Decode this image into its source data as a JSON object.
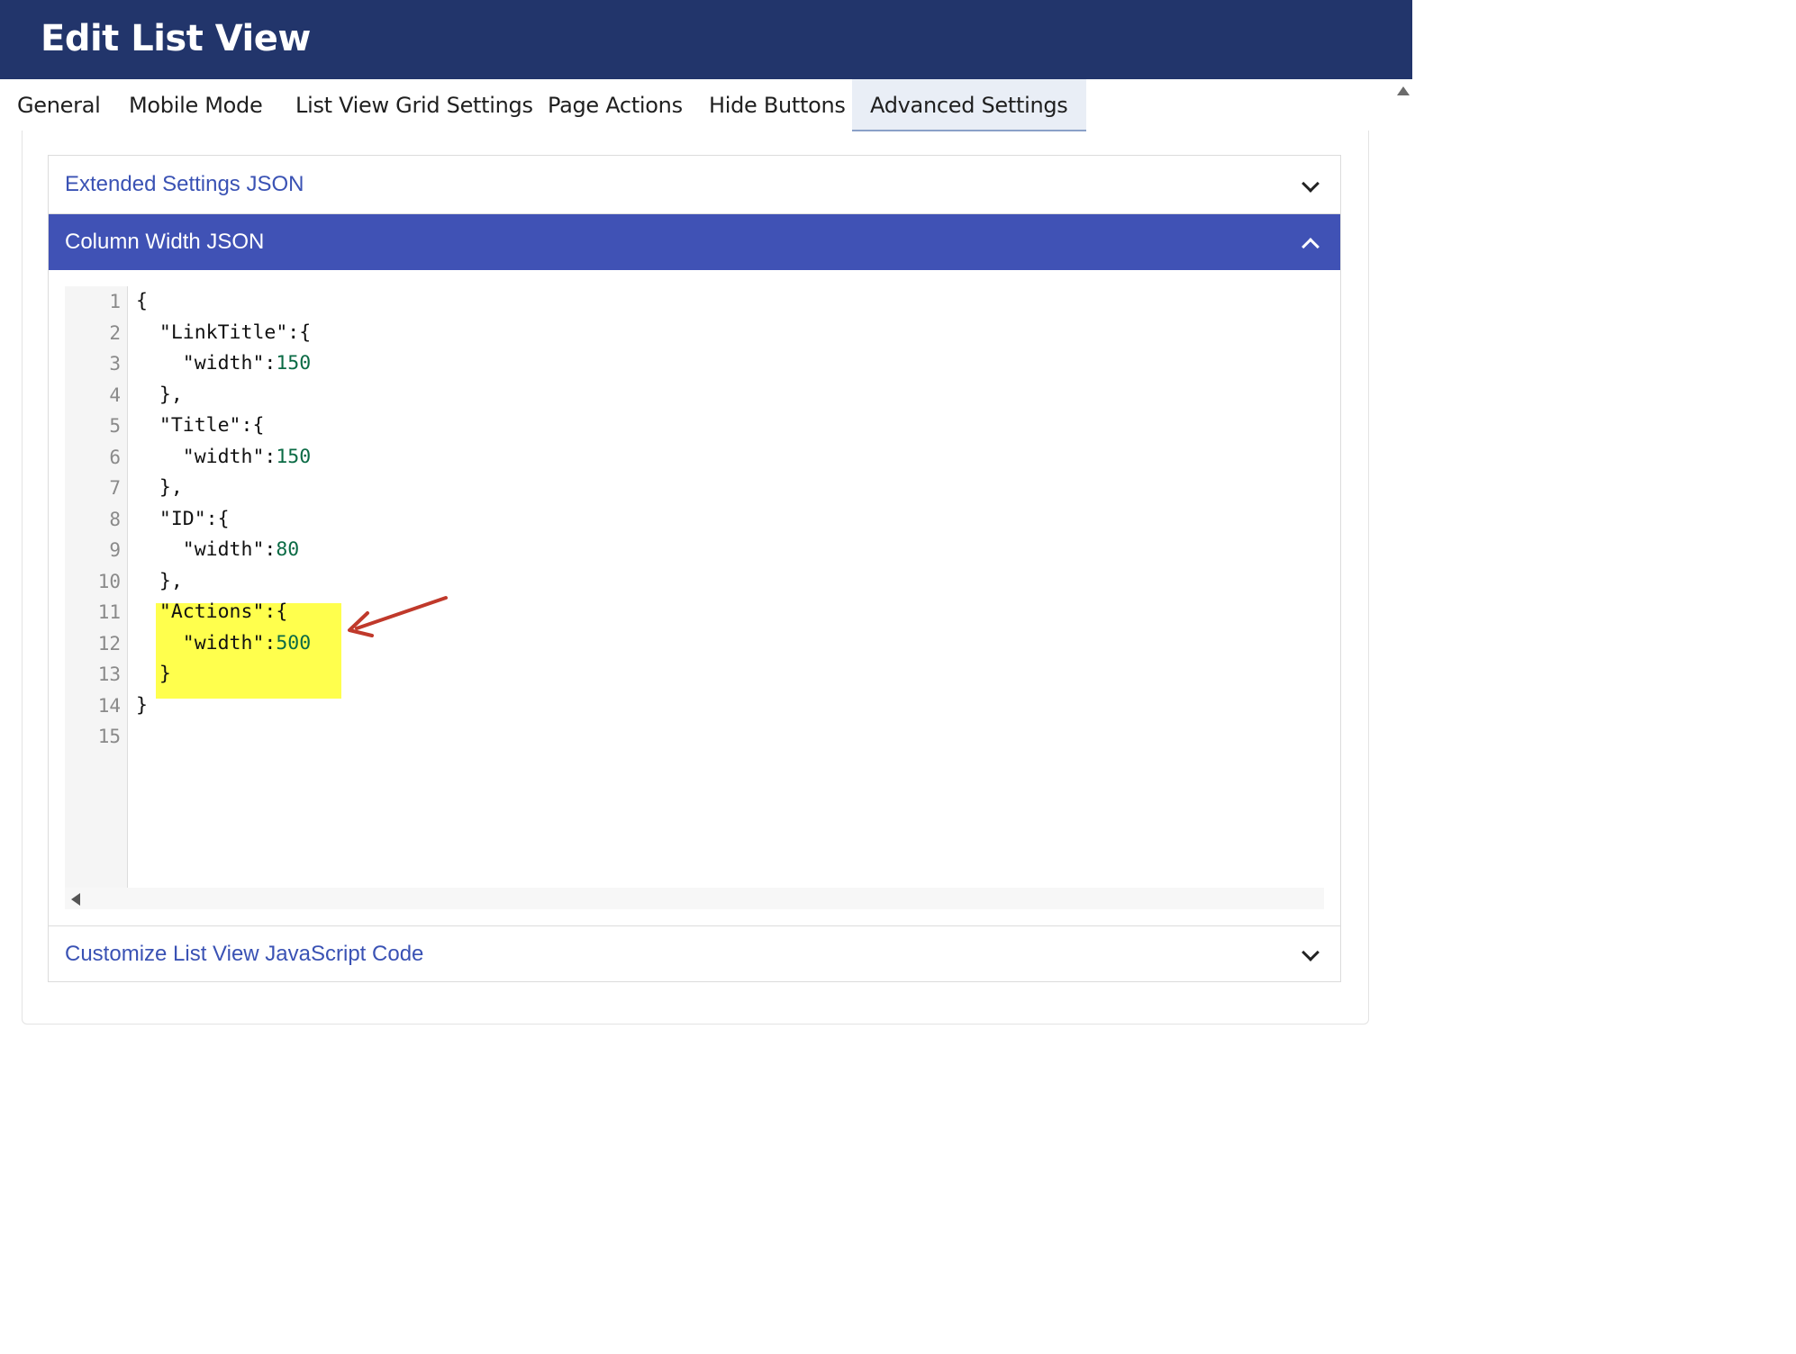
{
  "header": {
    "title": "Edit List View"
  },
  "tabs": [
    {
      "label": "General"
    },
    {
      "label": "Mobile Mode"
    },
    {
      "label": "List View Grid Settings"
    },
    {
      "label": "Page Actions"
    },
    {
      "label": "Hide Buttons"
    },
    {
      "label": "Advanced Settings",
      "active": true
    }
  ],
  "sections": [
    {
      "label": "Extended Settings JSON",
      "expanded": false
    },
    {
      "label": "Column Width JSON",
      "expanded": true
    },
    {
      "label": "Customize List View JavaScript Code",
      "expanded": false
    }
  ],
  "editor": {
    "line_numbers": [
      "1",
      "2",
      "3",
      "4",
      "5",
      "6",
      "7",
      "8",
      "9",
      "10",
      "11",
      "12",
      "13",
      "14",
      "15"
    ],
    "lines": [
      {
        "text": "{"
      },
      {
        "text": "  \"LinkTitle\":{"
      },
      {
        "text": "    \"width\":",
        "num": "150"
      },
      {
        "text": "  },"
      },
      {
        "text": "  \"Title\":{"
      },
      {
        "text": "    \"width\":",
        "num": "150"
      },
      {
        "text": "  },"
      },
      {
        "text": "  \"ID\":{"
      },
      {
        "text": "    \"width\":",
        "num": "80"
      },
      {
        "text": "  },"
      },
      {
        "text": "  \"Actions\":{"
      },
      {
        "text": "    \"width\":",
        "num": "500"
      },
      {
        "text": "  }"
      },
      {
        "text": "}"
      },
      {
        "text": ""
      }
    ]
  },
  "colors": {
    "header_bg": "#22356b",
    "accent": "#4052b5",
    "highlight": "#ffff4d",
    "annotation_arrow": "#c0392b",
    "number": "#0b6b45"
  },
  "icons": {
    "collapsed": "chevron-down-icon",
    "expanded": "chevron-up-icon",
    "annotation": "arrow-icon"
  }
}
